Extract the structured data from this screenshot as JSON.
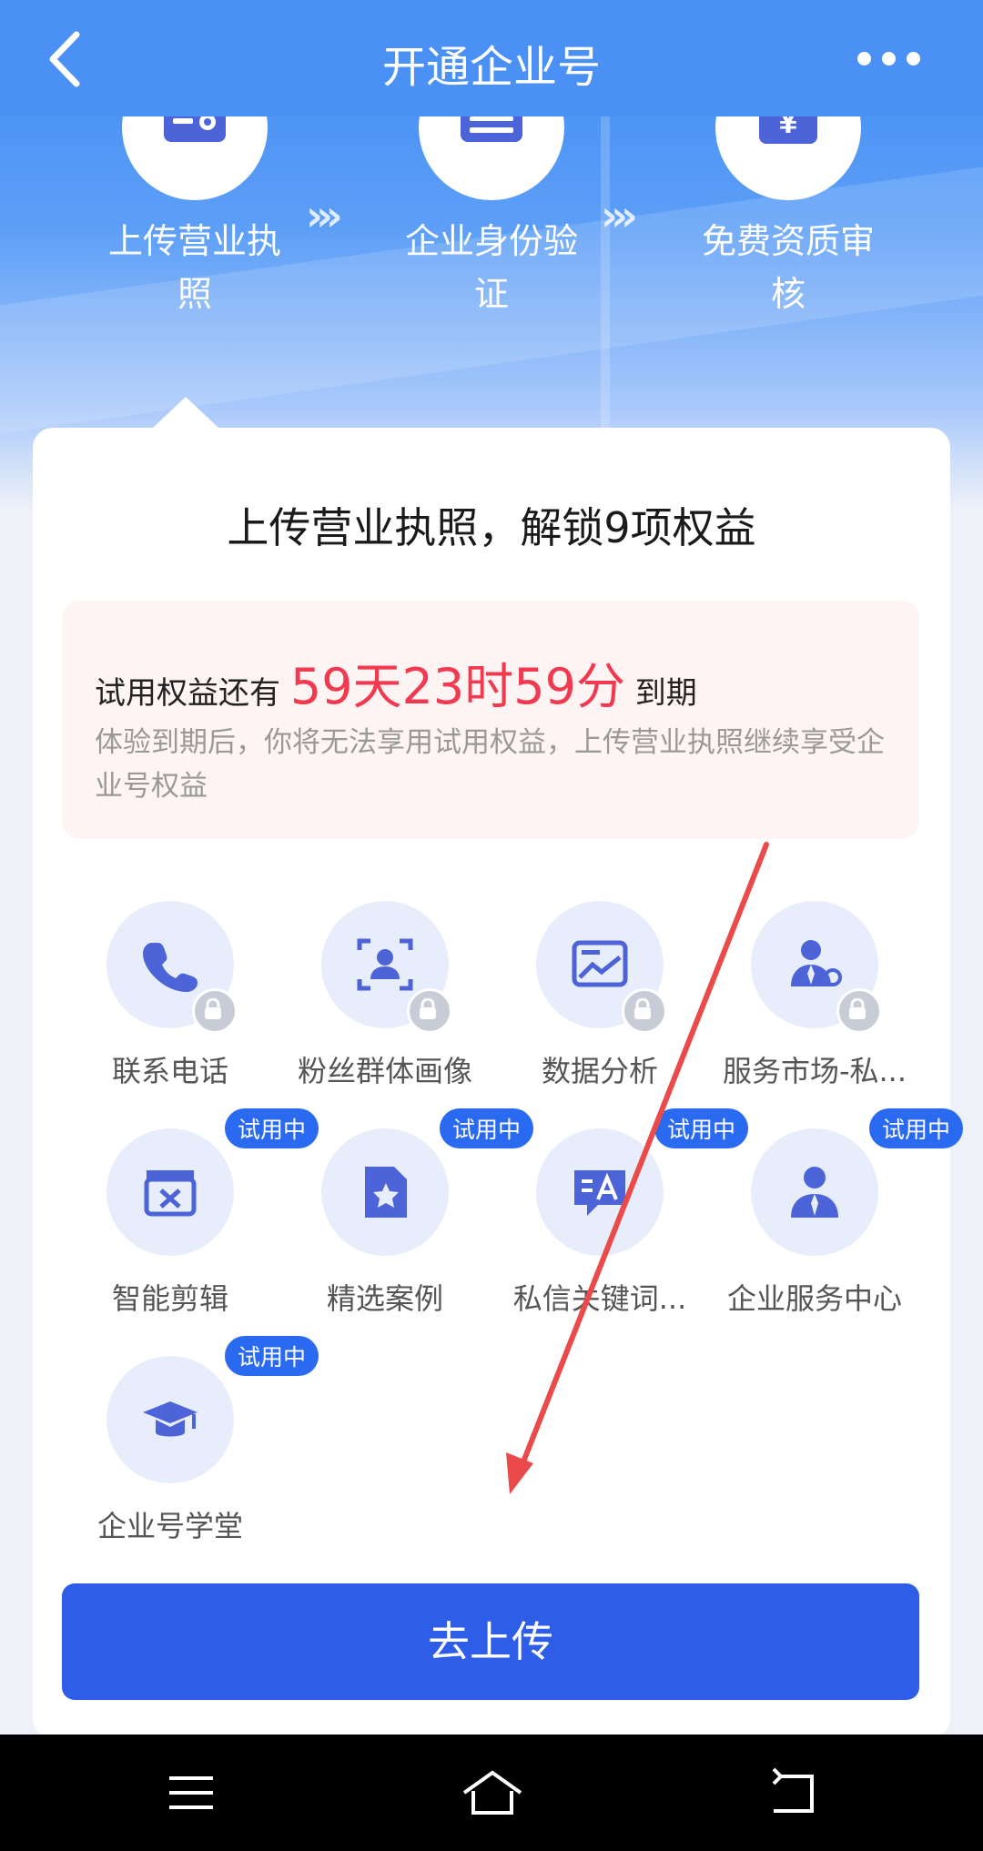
{
  "topbar": {
    "title": "开通企业号"
  },
  "steps": [
    {
      "label_line1": "上传营业执",
      "label_line2": "照"
    },
    {
      "label_line1": "企业身份验",
      "label_line2": "证"
    },
    {
      "label_line1": "免费资质审",
      "label_line2": "核"
    }
  ],
  "step_arrows": "›››",
  "step_icon_yen": "¥",
  "card": {
    "title": "上传营业执照，解锁9项权益",
    "trial": {
      "prefix": "试用权益还有",
      "countdown": "59天23时59分",
      "suffix": "到期",
      "description": "体验到期后，你将无法享用试用权益，上传营业执照继续享受企业号权益"
    },
    "perks": [
      {
        "label": "联系电话",
        "icon": "phone-icon",
        "locked": true,
        "badge": ""
      },
      {
        "label": "粉丝群体画像",
        "icon": "fan-portrait-icon",
        "locked": true,
        "badge": ""
      },
      {
        "label": "数据分析",
        "icon": "data-chart-icon",
        "locked": true,
        "badge": ""
      },
      {
        "label": "服务市场-私...",
        "icon": "service-market-icon",
        "locked": true,
        "badge": ""
      },
      {
        "label": "智能剪辑",
        "icon": "clapperboard-icon",
        "locked": false,
        "badge": "试用中"
      },
      {
        "label": "精选案例",
        "icon": "star-document-icon",
        "locked": false,
        "badge": "试用中"
      },
      {
        "label": "私信关键词...",
        "icon": "message-keyword-icon",
        "locked": false,
        "badge": "试用中"
      },
      {
        "label": "企业服务中心",
        "icon": "service-person-icon",
        "locked": false,
        "badge": "试用中"
      },
      {
        "label": "企业号学堂",
        "icon": "graduation-cap-icon",
        "locked": false,
        "badge": "试用中"
      }
    ],
    "upload_button": "去上传"
  },
  "colors": {
    "primary": "#2e5ee8",
    "countdown": "#f1394f",
    "badge": "#2a6af0",
    "icon": "#4d63d8"
  }
}
